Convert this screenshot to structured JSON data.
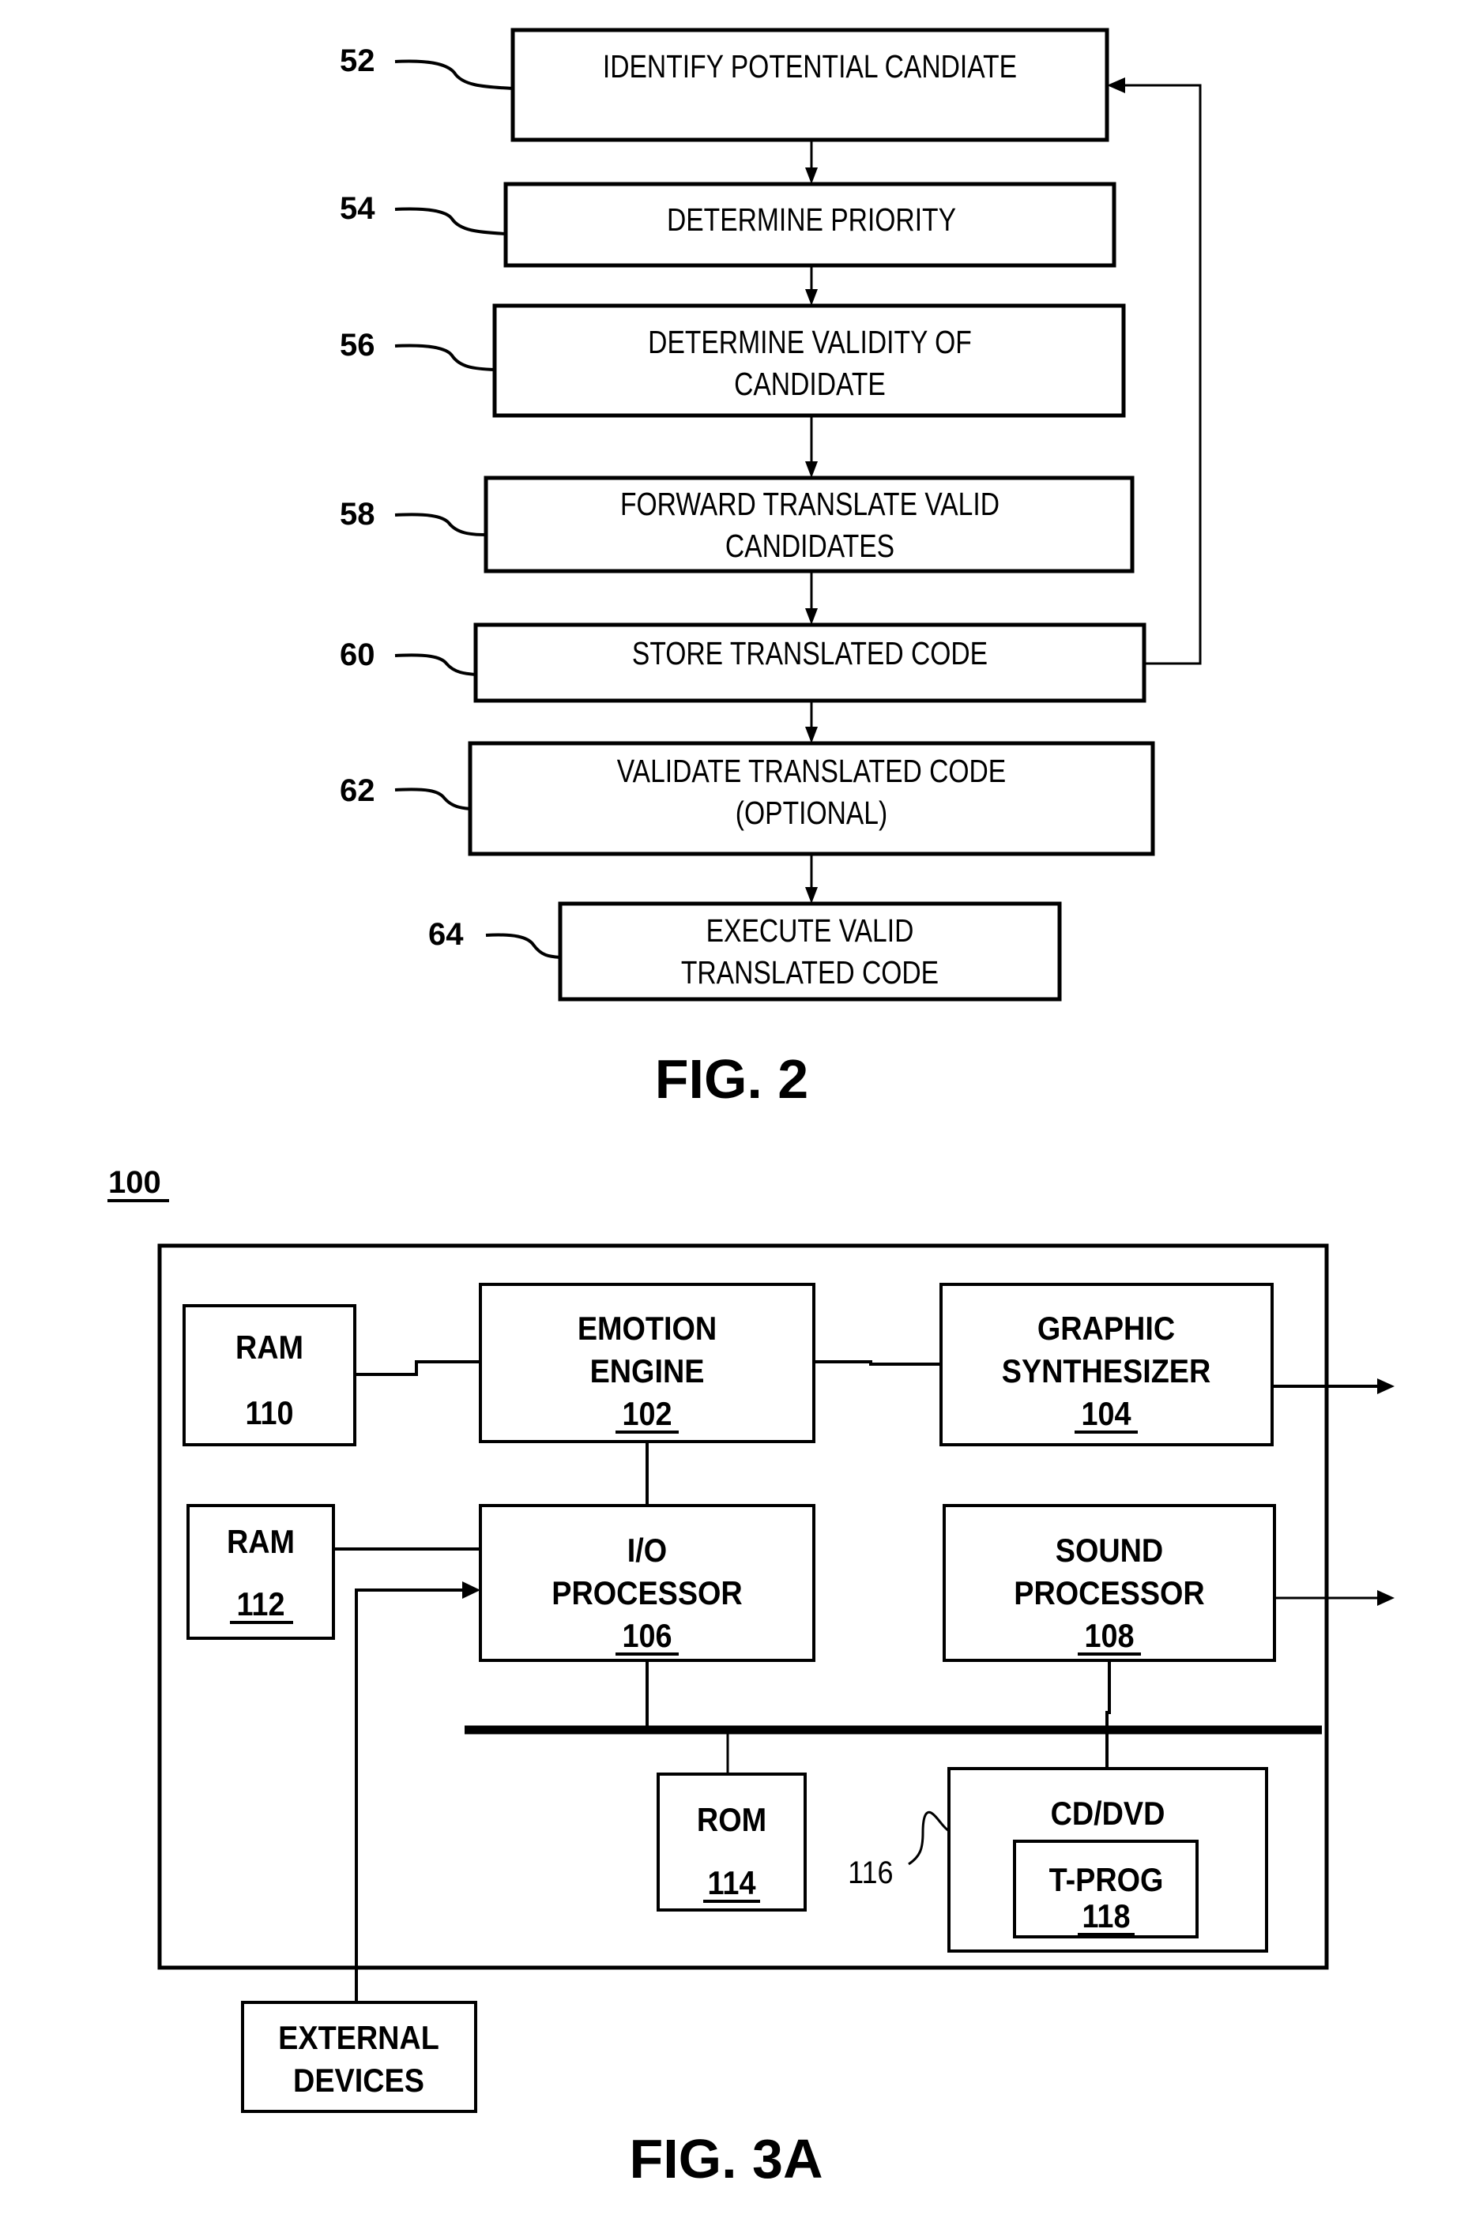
{
  "fig2": {
    "title": "FIG. 2",
    "steps": [
      {
        "ref": "52",
        "lines": [
          "IDENTIFY POTENTIAL CANDIATE"
        ]
      },
      {
        "ref": "54",
        "lines": [
          "DETERMINE PRIORITY"
        ]
      },
      {
        "ref": "56",
        "lines": [
          "DETERMINE VALIDITY OF",
          "CANDIDATE"
        ]
      },
      {
        "ref": "58",
        "lines": [
          "FORWARD TRANSLATE VALID",
          "CANDIDATES"
        ]
      },
      {
        "ref": "60",
        "lines": [
          "STORE TRANSLATED CODE"
        ]
      },
      {
        "ref": "62",
        "lines": [
          "VALIDATE TRANSLATED CODE",
          "(OPTIONAL)"
        ]
      },
      {
        "ref": "64",
        "lines": [
          "EXECUTE VALID",
          "TRANSLATED CODE"
        ]
      }
    ],
    "feedback": {
      "from": "60",
      "to": "52"
    }
  },
  "fig3a": {
    "title": "FIG. 3A",
    "system_ref": "100",
    "blocks": {
      "ram110": {
        "label": "RAM",
        "ref": "110",
        "ref_underlined": false
      },
      "emotion_engine": {
        "lines": [
          "EMOTION",
          "ENGINE"
        ],
        "ref": "102"
      },
      "graphic_synth": {
        "lines": [
          "GRAPHIC",
          "SYNTHESIZER"
        ],
        "ref": "104"
      },
      "ram112": {
        "label": "RAM",
        "ref": "112"
      },
      "io_processor": {
        "lines": [
          "I/O",
          "PROCESSOR"
        ],
        "ref": "106"
      },
      "sound_processor": {
        "lines": [
          "SOUND",
          "PROCESSOR"
        ],
        "ref": "108"
      },
      "rom": {
        "label": "ROM",
        "ref": "114"
      },
      "cd_dvd": {
        "label": "CD/DVD",
        "ref": "116"
      },
      "t_prog": {
        "label": "T-PROG",
        "ref": "118"
      },
      "external": {
        "lines": [
          "EXTERNAL",
          "DEVICES"
        ]
      }
    }
  }
}
